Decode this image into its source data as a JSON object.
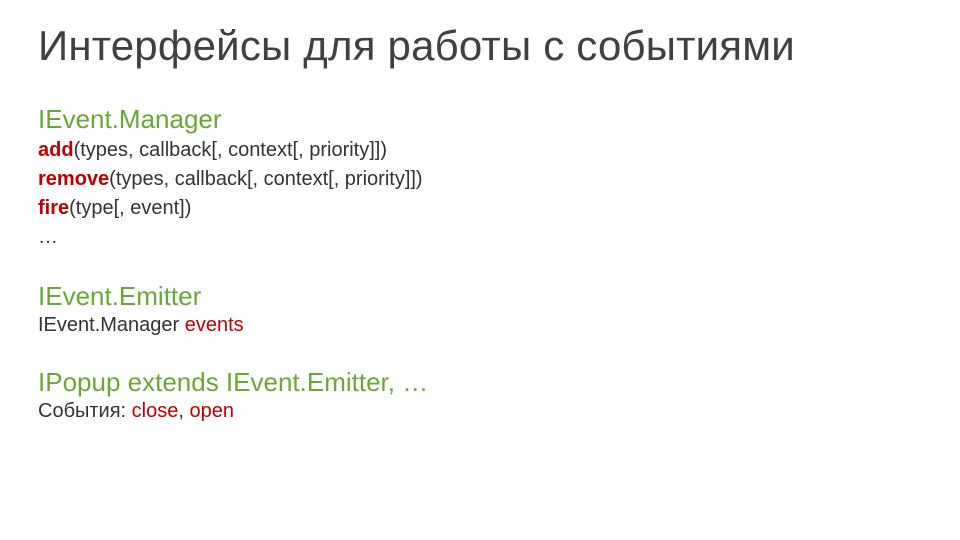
{
  "title": "Интерфейсы для работы с событиями",
  "sections": {
    "ieventmanager": {
      "heading": "IEvent.Manager",
      "methods": {
        "add": {
          "name": "add",
          "sig": "(types, callback[, context[, priority]])"
        },
        "remove": {
          "name": "remove",
          "sig": "(types, callback[, context[, priority]])"
        },
        "fire": {
          "name": "fire",
          "sig": "(type[, event])"
        }
      },
      "ellipsis": "…"
    },
    "ieventemitter": {
      "heading": "IEvent.Emitter",
      "line_prefix": "IEvent.Manager ",
      "line_keyword": "events"
    },
    "ipopup": {
      "heading": "IPopup extends IEvent.Emitter, …",
      "events_label": "События: ",
      "event1": "close",
      "sep": ", ",
      "event2": "open"
    }
  }
}
